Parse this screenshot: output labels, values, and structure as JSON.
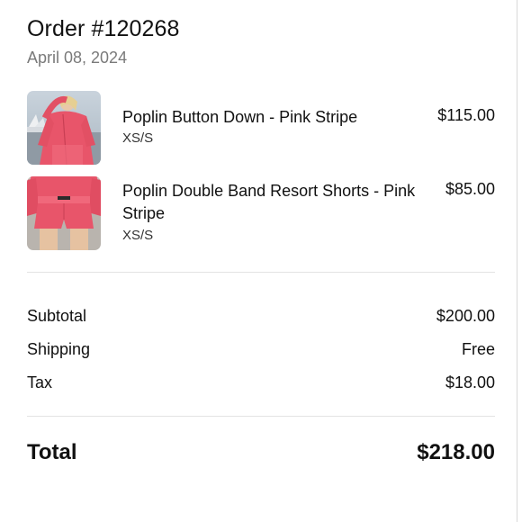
{
  "order": {
    "title": "Order #120268",
    "date": "April 08, 2024"
  },
  "items": [
    {
      "name": "Poplin Button Down - Pink Stripe",
      "variant": "XS/S",
      "price": "$115.00",
      "image": "pink-shirt-photo"
    },
    {
      "name": "Poplin Double Band Resort Shorts - Pink Stripe",
      "variant": "XS/S",
      "price": "$85.00",
      "image": "pink-shorts-photo"
    }
  ],
  "summary": {
    "subtotal_label": "Subtotal",
    "subtotal_value": "$200.00",
    "shipping_label": "Shipping",
    "shipping_value": "Free",
    "tax_label": "Tax",
    "tax_value": "$18.00",
    "total_label": "Total",
    "total_value": "$218.00"
  },
  "colors": {
    "product_pink": "#e8556a",
    "muted_text": "#7a7a7a",
    "divider": "#e3e3e3"
  }
}
